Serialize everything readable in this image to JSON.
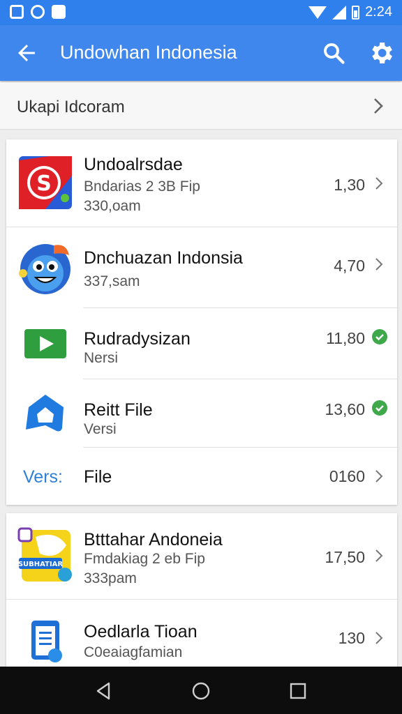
{
  "status_bar": {
    "time": "2:24"
  },
  "app_bar": {
    "title": "Undowhan Indonesia"
  },
  "breadcrumb": {
    "text": "Ukapi Idcoram"
  },
  "list": [
    {
      "name": "Undoalrsdae",
      "sub1": "Bndarias 2 3B Fip",
      "sub2": "330,oam",
      "value": "1,30",
      "trail": "chevron"
    },
    {
      "name": "Dnchuazan Indonsia",
      "sub1": "337,sam",
      "value": "4,70",
      "trail": "chevron"
    },
    {
      "name": "Rudradysizan",
      "sub1": "Nersi",
      "value": "11,80",
      "trail": "check"
    },
    {
      "name": "Reitt File",
      "sub1": "Versi",
      "value": "13,60",
      "trail": "check"
    },
    {
      "label": "Vers:",
      "name": "File",
      "value": "0160",
      "trail": "chevron"
    }
  ],
  "list2": [
    {
      "name": "Btttahar Andoneia",
      "sub1": "Fmdakiag 2 eb Fip",
      "sub2": "333pam",
      "value": "17,50",
      "trail": "chevron",
      "icon_text": "SUBHATIAR"
    },
    {
      "name": "Oedlarla Tioan",
      "sub1": "C0eaiagfamian",
      "value": "130",
      "trail": "chevron"
    }
  ],
  "colors": {
    "app_bar": "#3f87ec",
    "status_bar": "#2f80ed",
    "check": "#3ea84a",
    "accent_label": "#2f7fd6"
  },
  "icons": [
    "back-arrow-icon",
    "search-icon",
    "gear-icon",
    "chevron-right-icon",
    "check-circle-icon"
  ]
}
